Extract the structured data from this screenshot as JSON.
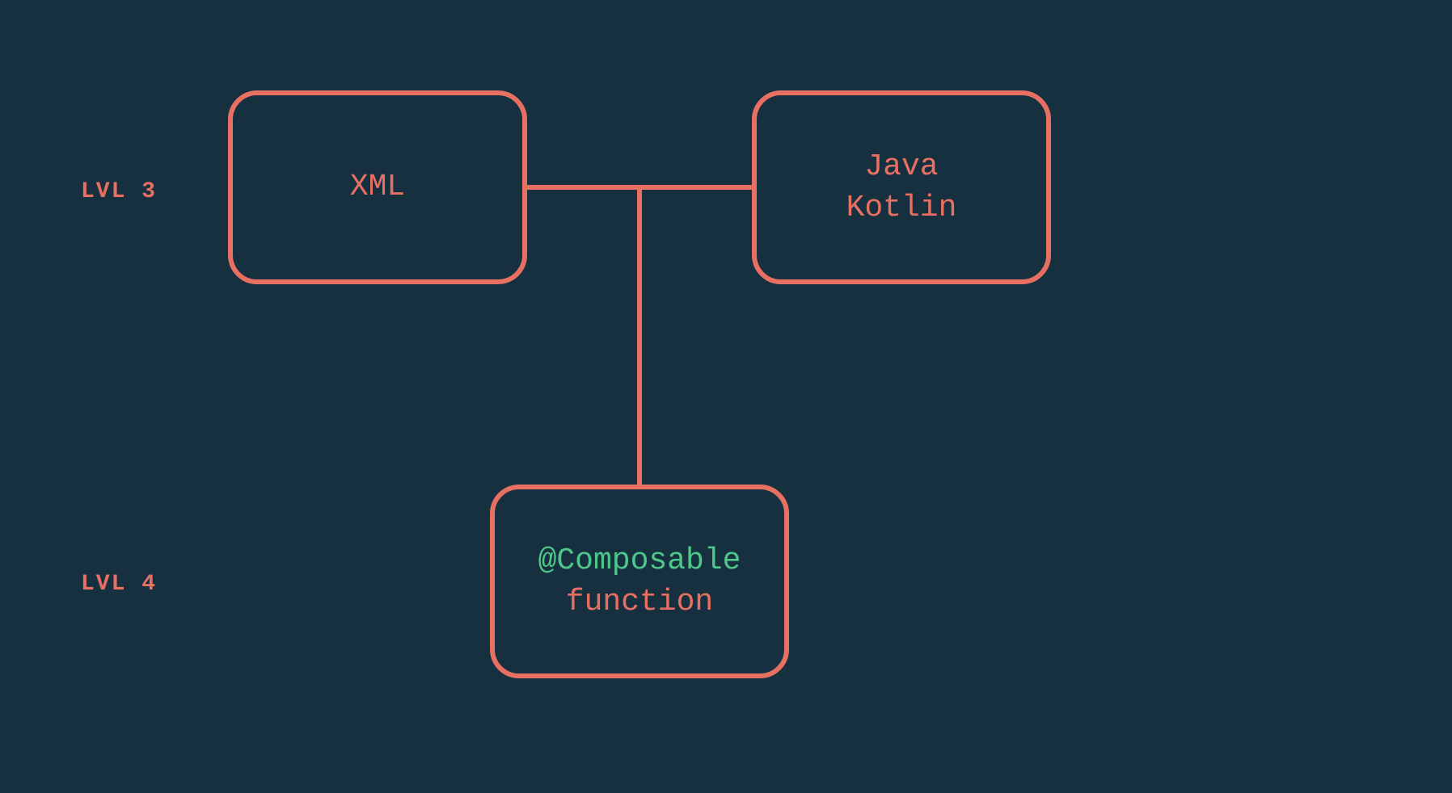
{
  "labels": {
    "level3": "LVL 3",
    "level4": "LVL 4"
  },
  "nodes": {
    "xml": {
      "text": "XML"
    },
    "javakotlin": {
      "line1": "Java",
      "line2": "Kotlin"
    },
    "composable": {
      "line1": "@Composable",
      "line2": "function"
    }
  },
  "colors": {
    "background": "#163040",
    "accent": "#e87062",
    "highlight": "#4ec88a"
  }
}
